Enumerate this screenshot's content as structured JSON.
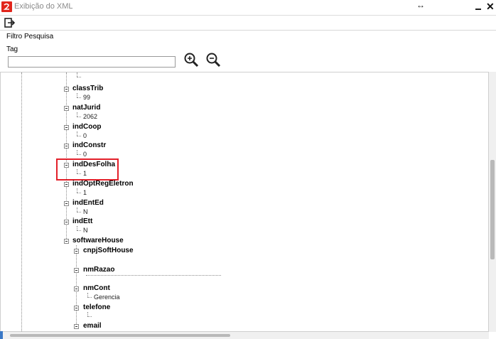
{
  "window": {
    "title": "Exibição do XML",
    "resize_glyph": "↔",
    "close_glyph": "✕",
    "logo_color": "#e1251b"
  },
  "toolbar": {
    "exit_icon": "exit-icon"
  },
  "filter": {
    "section_label": "Filtro Pesquisa",
    "tag_label": "Tag",
    "tag_value": "",
    "zoom_in_icon": "zoom-in-icon",
    "zoom_out_icon": "zoom-out-icon"
  },
  "tree": {
    "highlight_color": "#e3202a",
    "nodes": [
      {
        "label": "classTrib",
        "value": "99"
      },
      {
        "label": "natJurid",
        "value": "2062"
      },
      {
        "label": "indCoop",
        "value": "0"
      },
      {
        "label": "indConstr",
        "value": "0"
      },
      {
        "label": "indDesFolha",
        "value": "1"
      },
      {
        "label": "indOptRegEletron",
        "value": "1"
      },
      {
        "label": "indEntEd",
        "value": "N"
      },
      {
        "label": "indEtt",
        "value": "N"
      }
    ],
    "software_house": {
      "label": "softwareHouse",
      "children": [
        {
          "label": "cnpjSoftHouse",
          "value": ""
        },
        {
          "label": "nmRazao",
          "value": ""
        },
        {
          "label": "nmCont",
          "value": "Gerencia"
        },
        {
          "label": "telefone",
          "value": ""
        },
        {
          "label": "email",
          "value": ""
        }
      ]
    }
  }
}
